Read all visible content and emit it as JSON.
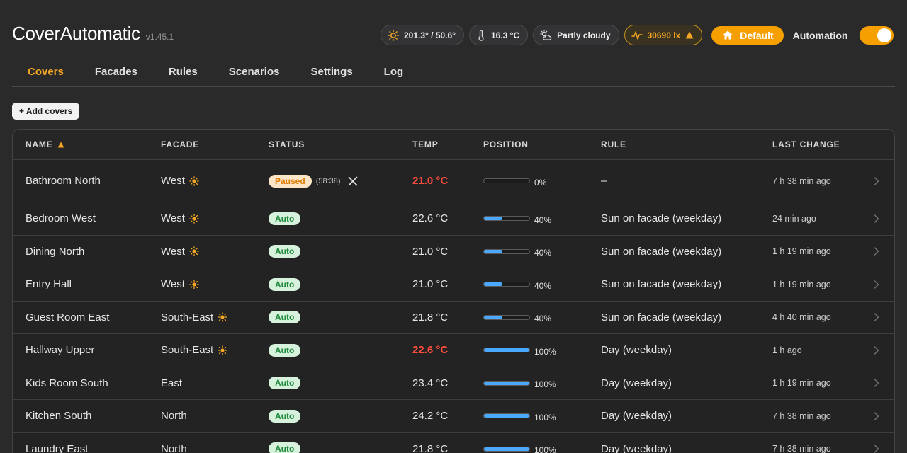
{
  "app": {
    "title": "CoverAutomatic",
    "version": "v1.45.1"
  },
  "status_chips": {
    "sun": "201.3° / 50.6°",
    "temperature": "16.3 °C",
    "weather": "Partly cloudy",
    "lux": "30690 lx"
  },
  "mode_button": "Default",
  "automation": {
    "label": "Automation",
    "enabled": true
  },
  "tabs": [
    {
      "label": "Covers",
      "active": true
    },
    {
      "label": "Facades",
      "active": false
    },
    {
      "label": "Rules",
      "active": false
    },
    {
      "label": "Scenarios",
      "active": false
    },
    {
      "label": "Settings",
      "active": false
    },
    {
      "label": "Log",
      "active": false
    }
  ],
  "add_button": "+ Add covers",
  "table": {
    "columns": [
      "NAME",
      "FACADE",
      "STATUS",
      "TEMP",
      "POSITION",
      "RULE",
      "LAST CHANGE"
    ],
    "sort_column": "NAME",
    "rows": [
      {
        "name": "Bathroom North",
        "facade": "West",
        "sunny": true,
        "status": "Paused",
        "timer": "(58:38)",
        "temp": "21.0 °C",
        "hot": true,
        "position": 0,
        "position_label": "0%",
        "rule": "–",
        "last_change": "7 h 38 min ago"
      },
      {
        "name": "Bedroom West",
        "facade": "West",
        "sunny": true,
        "status": "Auto",
        "timer": "",
        "temp": "22.6 °C",
        "hot": false,
        "position": 40,
        "position_label": "40%",
        "rule": "Sun on facade (weekday)",
        "last_change": "24 min ago"
      },
      {
        "name": "Dining North",
        "facade": "West",
        "sunny": true,
        "status": "Auto",
        "timer": "",
        "temp": "21.0 °C",
        "hot": false,
        "position": 40,
        "position_label": "40%",
        "rule": "Sun on facade (weekday)",
        "last_change": "1 h 19 min ago"
      },
      {
        "name": "Entry Hall",
        "facade": "West",
        "sunny": true,
        "status": "Auto",
        "timer": "",
        "temp": "21.0 °C",
        "hot": false,
        "position": 40,
        "position_label": "40%",
        "rule": "Sun on facade (weekday)",
        "last_change": "1 h 19 min ago"
      },
      {
        "name": "Guest Room East",
        "facade": "South-East",
        "sunny": true,
        "status": "Auto",
        "timer": "",
        "temp": "21.8 °C",
        "hot": false,
        "position": 40,
        "position_label": "40%",
        "rule": "Sun on facade (weekday)",
        "last_change": "4 h 40 min ago"
      },
      {
        "name": "Hallway Upper",
        "facade": "South-East",
        "sunny": true,
        "status": "Auto",
        "timer": "",
        "temp": "22.6 °C",
        "hot": true,
        "position": 100,
        "position_label": "100%",
        "rule": "Day (weekday)",
        "last_change": "1 h ago"
      },
      {
        "name": "Kids Room South",
        "facade": "East",
        "sunny": false,
        "status": "Auto",
        "timer": "",
        "temp": "23.4 °C",
        "hot": false,
        "position": 100,
        "position_label": "100%",
        "rule": "Day (weekday)",
        "last_change": "1 h 19 min ago"
      },
      {
        "name": "Kitchen South",
        "facade": "North",
        "sunny": false,
        "status": "Auto",
        "timer": "",
        "temp": "24.2 °C",
        "hot": false,
        "position": 100,
        "position_label": "100%",
        "rule": "Day (weekday)",
        "last_change": "7 h 38 min ago"
      },
      {
        "name": "Laundry East",
        "facade": "North",
        "sunny": false,
        "status": "Auto",
        "timer": "",
        "temp": "21.8 °C",
        "hot": false,
        "position": 100,
        "position_label": "100%",
        "rule": "Day (weekday)",
        "last_change": "7 h 38 min ago"
      }
    ]
  },
  "colors": {
    "accent": "#f59f00",
    "hot": "#ff4d3d",
    "auto_badge": "#d7f2dc",
    "paused_badge": "#fde6c8",
    "position_fill": "#4aa8ff"
  }
}
